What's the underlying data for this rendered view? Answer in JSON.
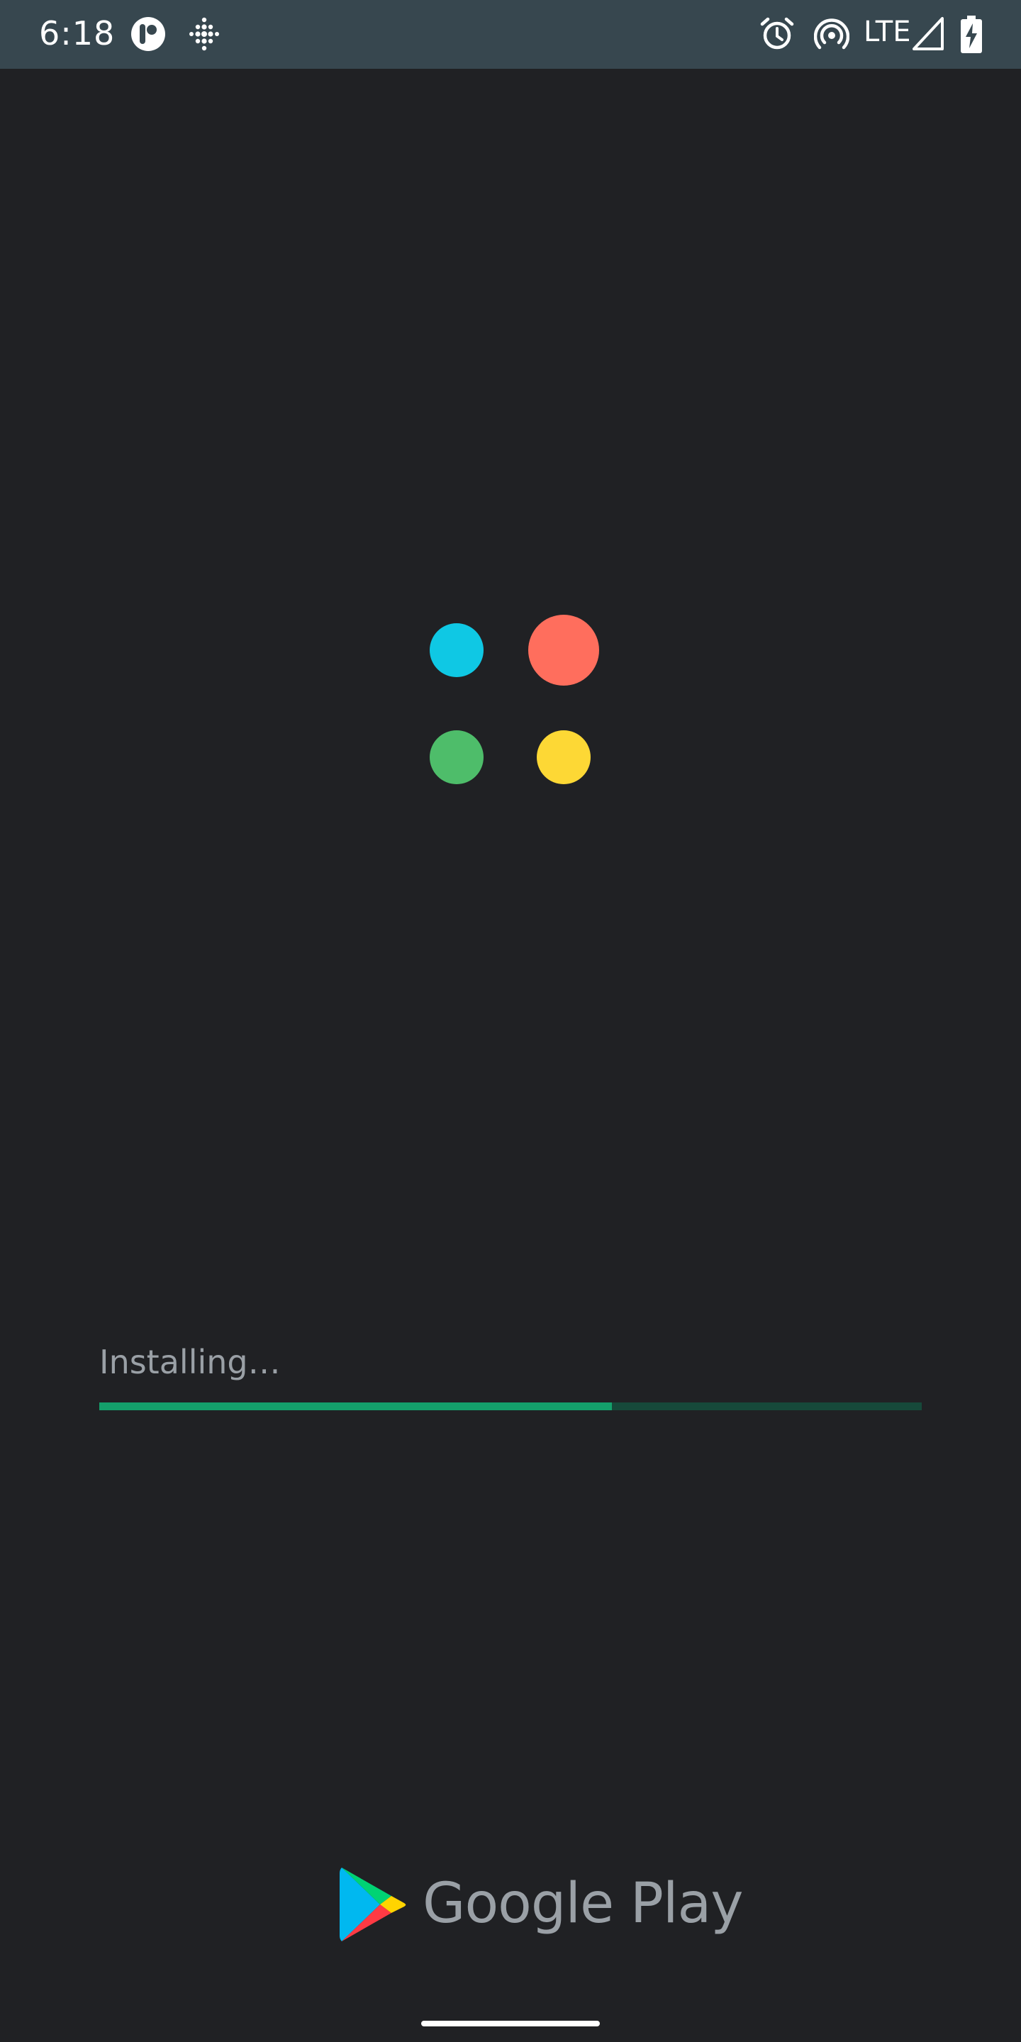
{
  "status_bar": {
    "time": "6:18",
    "network_type": "LTE",
    "icons": [
      "app-notification-icon",
      "fitbit-icon",
      "alarm-icon",
      "hotspot-icon",
      "cellular-signal-icon",
      "battery-charging-icon"
    ]
  },
  "app_logo": {
    "name": "four-dots-logo-icon",
    "colors": {
      "top_left": "#0fc8e4",
      "top_right": "#ff6e5d",
      "bottom_left": "#4ebd6a",
      "bottom_right": "#fdd835"
    }
  },
  "install": {
    "label": "Installing…",
    "progress_fraction": 0.623,
    "fill_color": "#14a06b",
    "track_color": "#16493a"
  },
  "footer": {
    "brand_text": "Google Play",
    "logo_icon": "google-play-icon"
  },
  "colors": {
    "background": "#202124",
    "status_bar": "#37474f"
  }
}
